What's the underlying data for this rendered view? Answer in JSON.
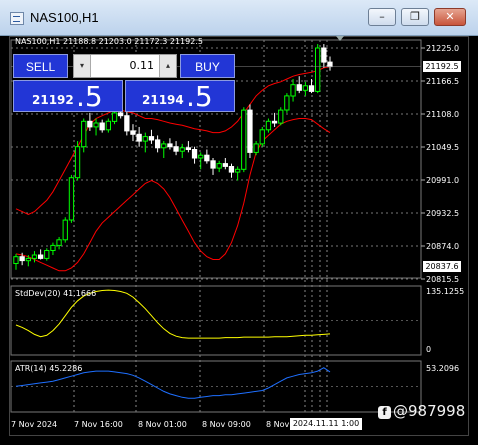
{
  "window": {
    "title": "NAS100,H1",
    "buttons": {
      "minimize": "–",
      "restore": "❐",
      "close": "✕"
    }
  },
  "chart_header": "NAS100,H1  21188.8 21203.0 21172.3 21192.5",
  "trade_panel": {
    "sell_label": "SELL",
    "buy_label": "BUY",
    "lot": "0.11",
    "sell_price_main": "21192",
    "sell_price_big": ".5",
    "buy_price_main": "21194",
    "buy_price_big": ".5"
  },
  "price_axis": {
    "labels": [
      "21225.0",
      "21166.5",
      "21108.0",
      "21049.5",
      "20991.0",
      "20932.5",
      "20874.0",
      "20815.5"
    ],
    "current_price_tag": "21192.5",
    "low_tag": "20837.6"
  },
  "indicators": {
    "stddev": {
      "label": "StdDev(20) 41.1666",
      "max": "135.1255",
      "min": "0"
    },
    "atr": {
      "label": "ATR(14) 45.2286",
      "max": "53.2096"
    }
  },
  "time_axis": {
    "labels": [
      "7 Nov 2024",
      "7 Nov 16:00",
      "8 Nov 01:00",
      "8 Nov 09:00",
      "8 Nov"
    ],
    "cursor_time": "2024.11.11 1:00"
  },
  "watermark": {
    "icon": "f",
    "text": "@987998"
  },
  "colors": {
    "bull": "#00ff00",
    "bear": "#ffffff",
    "envelope": "#ff0000",
    "stddev": "#ffff00",
    "atr": "#1e6fff",
    "panel": "#2236d6"
  },
  "chart_data": {
    "type": "candlestick",
    "timeframe": "H1",
    "candles": [
      [
        20843,
        20860,
        20832,
        20855
      ],
      [
        20855,
        20862,
        20840,
        20848
      ],
      [
        20848,
        20858,
        20838,
        20852
      ],
      [
        20852,
        20865,
        20845,
        20858
      ],
      [
        20858,
        20868,
        20850,
        20852
      ],
      [
        20852,
        20870,
        20848,
        20866
      ],
      [
        20866,
        20880,
        20858,
        20875
      ],
      [
        20875,
        20890,
        20868,
        20885
      ],
      [
        20885,
        20925,
        20880,
        20920
      ],
      [
        20920,
        21000,
        20915,
        20995
      ],
      [
        20995,
        21060,
        20990,
        21050
      ],
      [
        21050,
        21100,
        21040,
        21095
      ],
      [
        21095,
        21110,
        21078,
        21085
      ],
      [
        21085,
        21100,
        21070,
        21092
      ],
      [
        21092,
        21098,
        21075,
        21080
      ],
      [
        21080,
        21100,
        21075,
        21095
      ],
      [
        21095,
        21120,
        21090,
        21110
      ],
      [
        21110,
        21125,
        21100,
        21105
      ],
      [
        21105,
        21115,
        21070,
        21078
      ],
      [
        21078,
        21090,
        21060,
        21072
      ],
      [
        21072,
        21085,
        21050,
        21060
      ],
      [
        21060,
        21075,
        21040,
        21068
      ],
      [
        21068,
        21080,
        21055,
        21062
      ],
      [
        21062,
        21070,
        21040,
        21048
      ],
      [
        21048,
        21060,
        21030,
        21055
      ],
      [
        21055,
        21065,
        21045,
        21050
      ],
      [
        21050,
        21060,
        21035,
        21042
      ],
      [
        21042,
        21055,
        21030,
        21048
      ],
      [
        21048,
        21060,
        21040,
        21045
      ],
      [
        21045,
        21050,
        21020,
        21030
      ],
      [
        21030,
        21040,
        21010,
        21035
      ],
      [
        21035,
        21045,
        21020,
        21025
      ],
      [
        21025,
        21030,
        21000,
        21012
      ],
      [
        21012,
        21025,
        21005,
        21020
      ],
      [
        21020,
        21030,
        21010,
        21015
      ],
      [
        21015,
        21020,
        20995,
        21005
      ],
      [
        21005,
        21015,
        20990,
        21010
      ],
      [
        21010,
        21120,
        21005,
        21115
      ],
      [
        21115,
        21125,
        21030,
        21040
      ],
      [
        21040,
        21060,
        21035,
        21055
      ],
      [
        21055,
        21085,
        21050,
        21080
      ],
      [
        21080,
        21100,
        21075,
        21095
      ],
      [
        21095,
        21110,
        21085,
        21092
      ],
      [
        21092,
        21120,
        21088,
        21115
      ],
      [
        21115,
        21145,
        21110,
        21140
      ],
      [
        21140,
        21170,
        21130,
        21160
      ],
      [
        21160,
        21175,
        21145,
        21150
      ],
      [
        21150,
        21165,
        21140,
        21158
      ],
      [
        21158,
        21170,
        21145,
        21148
      ],
      [
        21148,
        21232,
        21145,
        21225
      ],
      [
        21225,
        21232,
        21190,
        21200
      ],
      [
        21200,
        21210,
        21185,
        21192
      ]
    ],
    "envelope_upper": [
      20940,
      20935,
      20930,
      20935,
      20945,
      20955,
      20970,
      20990,
      21010,
      21030,
      21050,
      21070,
      21090,
      21100,
      21105,
      21110,
      21115,
      21115,
      21112,
      21110,
      21105,
      21100,
      21100,
      21098,
      21095,
      21092,
      21090,
      21088,
      21085,
      21082,
      21080,
      21078,
      21075,
      21075,
      21078,
      21085,
      21095,
      21110,
      21125,
      21140,
      21150,
      21158,
      21162,
      21165,
      21170,
      21175,
      21178,
      21180,
      21182,
      21185,
      21190,
      21192
    ],
    "envelope_lower": [
      20860,
      20858,
      20855,
      20850,
      20845,
      20840,
      20835,
      20830,
      20830,
      20835,
      20845,
      20860,
      20880,
      20900,
      20915,
      20925,
      20935,
      20945,
      20955,
      20965,
      20975,
      20985,
      20990,
      20985,
      20975,
      20960,
      20940,
      20920,
      20900,
      20880,
      20865,
      20855,
      20850,
      20850,
      20860,
      20880,
      20910,
      20950,
      21000,
      21040,
      21060,
      21070,
      21080,
      21090,
      21095,
      21098,
      21100,
      21100,
      21098,
      21090,
      21082,
      21075
    ],
    "stddev_values": [
      60,
      55,
      48,
      40,
      35,
      38,
      48,
      62,
      80,
      98,
      112,
      122,
      128,
      132,
      134,
      135,
      134,
      132,
      128,
      120,
      108,
      95,
      80,
      65,
      52,
      42,
      36,
      33,
      32,
      32,
      32,
      32,
      32,
      32,
      33,
      33,
      33,
      34,
      34,
      34,
      34,
      34,
      35,
      35,
      35,
      36,
      37,
      38,
      38,
      39,
      40,
      41
    ],
    "atr_values": [
      28,
      29,
      30,
      31,
      32,
      33,
      34,
      36,
      38,
      40,
      42,
      44,
      45,
      46,
      46,
      46,
      45,
      44,
      43,
      41,
      38,
      34,
      30,
      26,
      22,
      19,
      17,
      15,
      14,
      14,
      15,
      16,
      17,
      17,
      18,
      18,
      19,
      20,
      21,
      22,
      23,
      26,
      30,
      34,
      38,
      40,
      42,
      43,
      44,
      46,
      50,
      45
    ]
  }
}
